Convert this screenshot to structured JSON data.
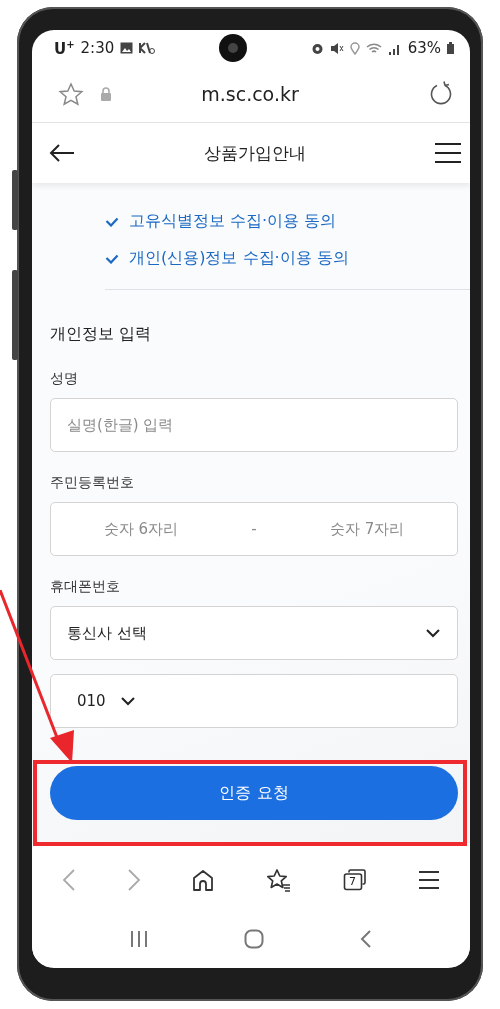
{
  "status_bar": {
    "carrier": "U$^{+}$",
    "time": "2:30",
    "battery": "63%"
  },
  "url_bar": {
    "url": "m.sc.co.kr"
  },
  "header": {
    "title": "상품가입안내"
  },
  "agreements": [
    {
      "label": "고유식별정보 수집·이용 동의",
      "checked": true
    },
    {
      "label": "개인(신용)정보 수집·이용 동의",
      "checked": true
    }
  ],
  "section_title": "개인정보 입력",
  "fields": [
    {
      "kind": "text",
      "label": "성명",
      "placeholder": "실명(한글) 입력"
    },
    {
      "kind": "split",
      "label": "주민등록번호",
      "placeholder": "숫자 6자리",
      "separator": "-",
      "placeholder_2": "숫자 7자리"
    },
    {
      "kind": "select",
      "label": "휴대폰번호",
      "value": "통신사 선택"
    },
    {
      "kind": "prefix",
      "value": "010"
    }
  ],
  "submit_button": "인증 요청",
  "browser_nav": {
    "tab_count": "7"
  }
}
